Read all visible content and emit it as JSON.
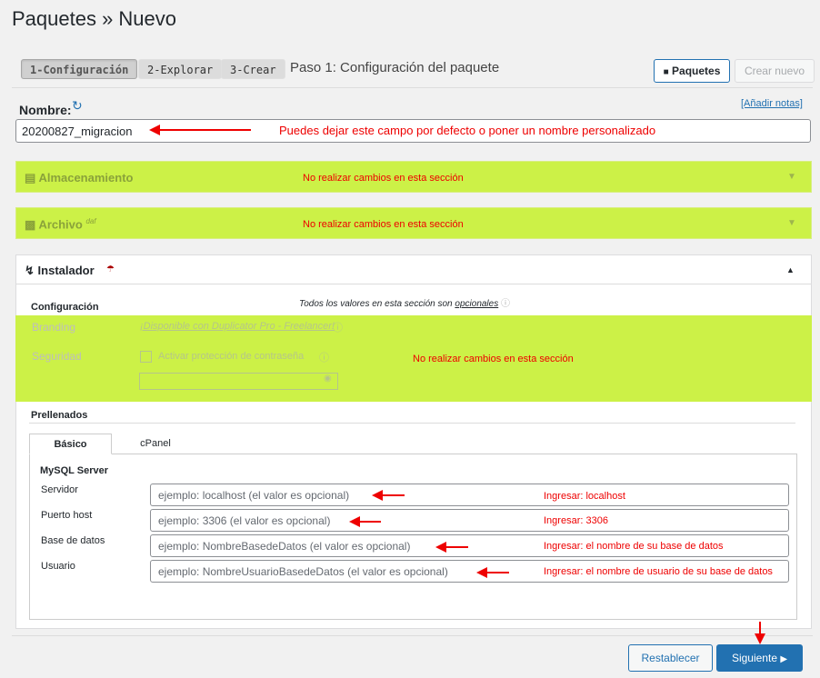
{
  "header": {
    "title": "Paquetes » Nuevo"
  },
  "steps": [
    {
      "label": "1-Configuración"
    },
    {
      "label": "2-Explorar"
    },
    {
      "label": "3-Crear"
    }
  ],
  "step_title": "Paso 1: Configuración del paquete",
  "toolbar": {
    "paquetes_label": "Paquetes",
    "crear_nuevo_label": "Crear nuevo"
  },
  "nombre": {
    "label": "Nombre:",
    "add_notes_link": "[Añadir notas]",
    "value": "20200827_migracion",
    "annotation": "Puedes dejar este campo por defecto o poner un nombre personalizado"
  },
  "sections": {
    "almacenamiento": {
      "title": "Almacenamiento",
      "note": "No realizar cambios en esta sección"
    },
    "archivo": {
      "title": "Archivo",
      "superscript": "daf",
      "note": "No realizar cambios en esta sección"
    },
    "instalador": {
      "title": "Instalador",
      "configuracion_label": "Configuración",
      "optional_note_prefix": "Todos los valores en esta sección son ",
      "optional_note_link": "opcionales",
      "branding_label": "Branding",
      "branding_value": "¡Disponible con Duplicator Pro - Freelancer!",
      "seguridad_label": "Seguridad",
      "password_checkbox_label": "Activar protección de contraseña",
      "note": "No realizar cambios en esta sección",
      "prellenados_label": "Prellenados",
      "tabs": [
        "Básico",
        "cPanel"
      ],
      "mysql_label": "MySQL Server",
      "fields": [
        {
          "label": "Servidor",
          "placeholder": "ejemplo: localhost (el valor es opcional)",
          "annotation": "Ingresar: localhost"
        },
        {
          "label": "Puerto host",
          "placeholder": "ejemplo: 3306 (el valor es opcional)",
          "annotation": "Ingresar: 3306"
        },
        {
          "label": "Base de datos",
          "placeholder": "ejemplo: NombreBasedeDatos (el valor es opcional)",
          "annotation": "Ingresar: el nombre de su base de datos"
        },
        {
          "label": "Usuario",
          "placeholder": "ejemplo: NombreUsuarioBasedeDatos (el valor es opcional)",
          "annotation": "Ingresar: el nombre de usuario de su base de datos"
        }
      ]
    }
  },
  "footer": {
    "reset_label": "Restablecer",
    "next_label": "Siguiente"
  },
  "colors": {
    "accent": "#2271b1",
    "highlight": "#ccf147",
    "annotation": "#ee0000"
  }
}
